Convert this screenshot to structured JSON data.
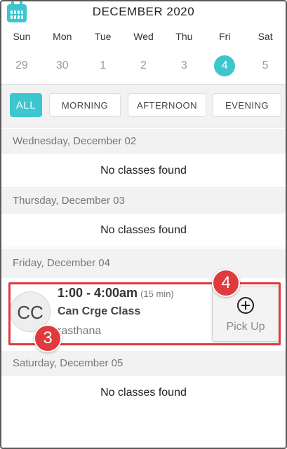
{
  "header": {
    "icon": "calendar-icon",
    "month_title": "DECEMBER 2020"
  },
  "weekdays": [
    "Sun",
    "Mon",
    "Tue",
    "Wed",
    "Thu",
    "Fri",
    "Sat"
  ],
  "dates": [
    "29",
    "30",
    "1",
    "2",
    "3",
    "4",
    "5"
  ],
  "selected_date": "4",
  "filters": [
    "ALL",
    "MORNING",
    "AFTERNOON",
    "EVENING"
  ],
  "active_filter": "ALL",
  "days": [
    {
      "header": "Wednesday, December 02",
      "message": "No classes found"
    },
    {
      "header": "Thursday, December 03",
      "message": "No classes found"
    },
    {
      "header": "Friday, December 04"
    },
    {
      "header": "Saturday, December 05",
      "message": "No classes found"
    }
  ],
  "class_item": {
    "avatar_initials": "CC",
    "time": "1:00 - 4:00am",
    "duration": "(15 min)",
    "name": "Can Crge Class",
    "instructor": "rasthana",
    "pickup_label": "Pick Up"
  },
  "annotations": {
    "badge_3": "3",
    "badge_4": "4"
  },
  "colors": {
    "accent": "#3cc6cf",
    "annotation": "#e0393e"
  }
}
